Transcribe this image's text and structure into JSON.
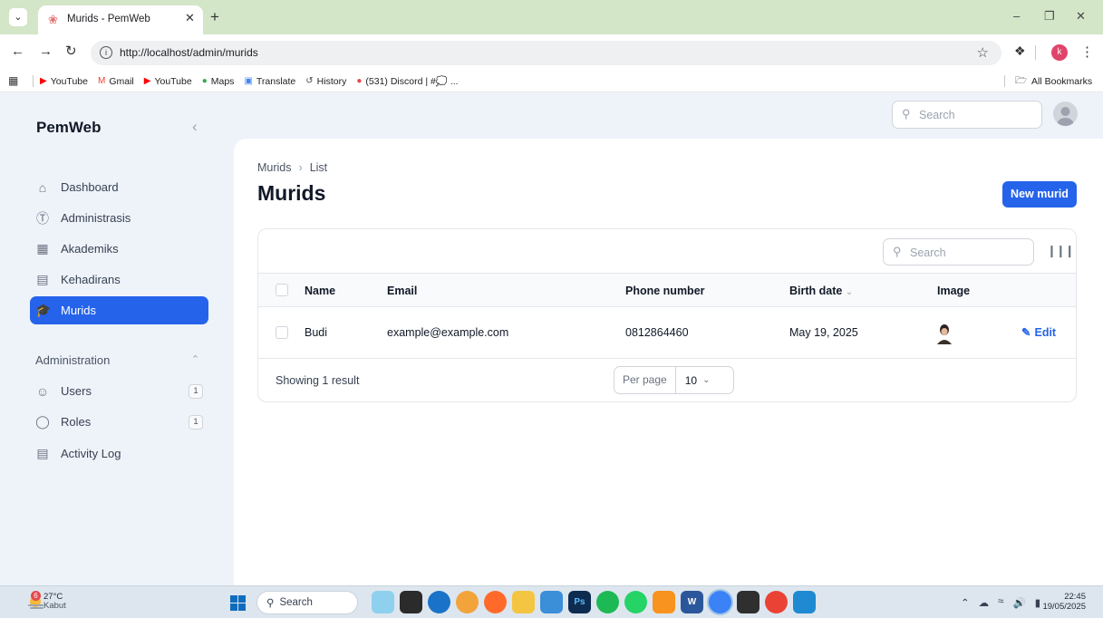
{
  "browser": {
    "tab_title": "Murids - PemWeb",
    "url": "http://localhost/admin/murids",
    "bookmarks": [
      {
        "label": "YouTube",
        "icon": "youtube-icon",
        "color": "#ff0000"
      },
      {
        "label": "Gmail",
        "icon": "gmail-icon",
        "color": "#ea4335"
      },
      {
        "label": "YouTube",
        "icon": "youtube-icon",
        "color": "#ff0000"
      },
      {
        "label": "Maps",
        "icon": "maps-icon",
        "color": "#34a853"
      },
      {
        "label": "Translate",
        "icon": "translate-icon",
        "color": "#4285f4"
      },
      {
        "label": "History",
        "icon": "history-icon",
        "color": "#444444"
      },
      {
        "label": "(531) Discord | #💭 ...",
        "icon": "discord-icon",
        "color": "#e5484d"
      }
    ],
    "all_bookmarks": "All Bookmarks",
    "profile_initial": "k"
  },
  "sidebar": {
    "brand": "PemWeb",
    "items": [
      {
        "label": "Dashboard",
        "icon": "home-icon",
        "active": false
      },
      {
        "label": "Administrasis",
        "icon": "dollar-circle-icon",
        "active": false
      },
      {
        "label": "Akademiks",
        "icon": "building-icon",
        "active": false
      },
      {
        "label": "Kehadirans",
        "icon": "clipboard-icon",
        "active": false
      },
      {
        "label": "Murids",
        "icon": "graduation-cap-icon",
        "active": true
      }
    ],
    "group": {
      "label": "Administration",
      "items": [
        {
          "label": "Users",
          "icon": "users-icon",
          "badge": "1"
        },
        {
          "label": "Roles",
          "icon": "shield-check-icon",
          "badge": "1"
        },
        {
          "label": "Activity Log",
          "icon": "document-icon",
          "badge": ""
        }
      ]
    }
  },
  "topbar": {
    "search_placeholder": "Search"
  },
  "page": {
    "breadcrumb": [
      "Murids",
      "List"
    ],
    "title": "Murids",
    "new_button": "New murid"
  },
  "table": {
    "search_placeholder": "Search",
    "columns": [
      "Name",
      "Email",
      "Phone number",
      "Birth date",
      "Image"
    ],
    "rows": [
      {
        "name": "Budi",
        "email": "example@example.com",
        "phone": "0812864460",
        "birth_date": "May 19, 2025",
        "action": "Edit"
      }
    ],
    "showing": "Showing 1 result",
    "per_page_label": "Per page",
    "per_page_value": "10"
  },
  "taskbar": {
    "weather_temp": "27°C",
    "weather_desc": "Kabut",
    "weather_badge": "6",
    "search": "Search",
    "time": "22:45",
    "date": "19/05/2025"
  },
  "colors": {
    "primary": "#2563eb",
    "tabstrip": "#d3e6c8"
  }
}
